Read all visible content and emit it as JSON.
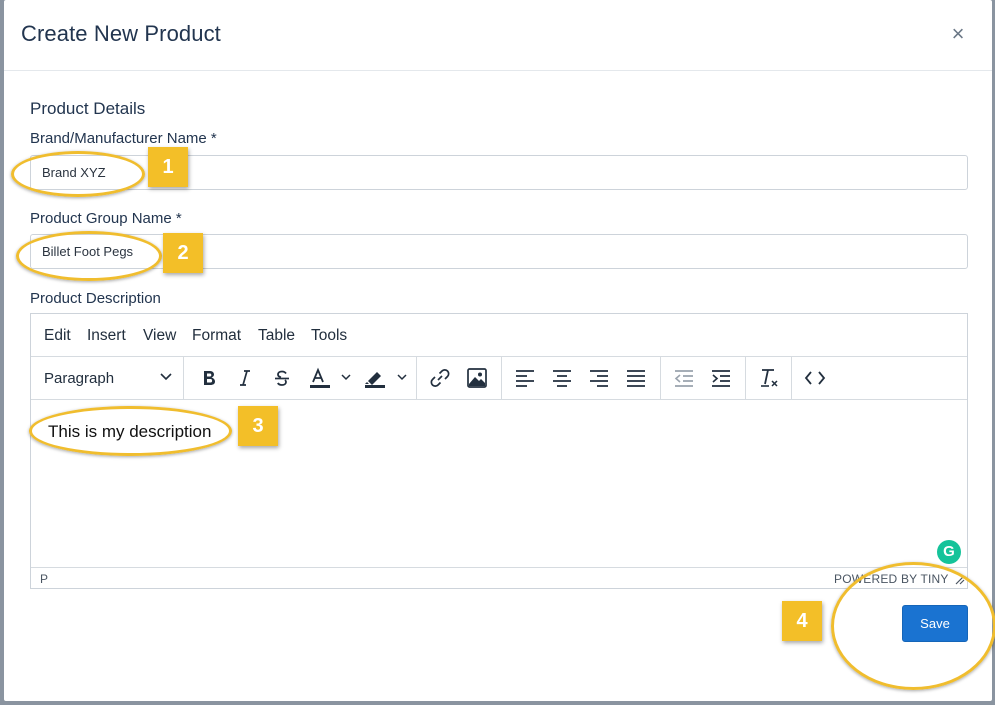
{
  "modal": {
    "title": "Create New Product",
    "close_icon_glyph": "×",
    "section_title": "Product Details"
  },
  "fields": {
    "brand_label": "Brand/Manufacturer Name *",
    "brand_value": "Brand XYZ",
    "group_label": "Product Group Name *",
    "group_value": "Billet Foot Pegs",
    "description_label": "Product Description"
  },
  "editor": {
    "menu": [
      "Edit",
      "Insert",
      "View",
      "Format",
      "Table",
      "Tools"
    ],
    "block_format": "Paragraph",
    "toolbar_icons": [
      "bold-icon",
      "italic-icon",
      "strikethrough-icon",
      "text-color-icon",
      "highlight-color-icon",
      "link-icon",
      "image-icon",
      "align-left-icon",
      "align-center-icon",
      "align-right-icon",
      "align-justify-icon",
      "outdent-icon",
      "indent-icon",
      "clear-formatting-icon",
      "source-code-icon"
    ],
    "content": "This is my description",
    "status_path": "P",
    "powered_by": "POWERED BY TINY",
    "grammarly_glyph": "G"
  },
  "actions": {
    "save_label": "Save"
  },
  "annotations": {
    "step1": "1",
    "step2": "2",
    "step3": "3",
    "step4": "4"
  },
  "colors": {
    "accent": "#1a73d1",
    "highlight": "#f3bf28",
    "title_text": "#22354f"
  }
}
